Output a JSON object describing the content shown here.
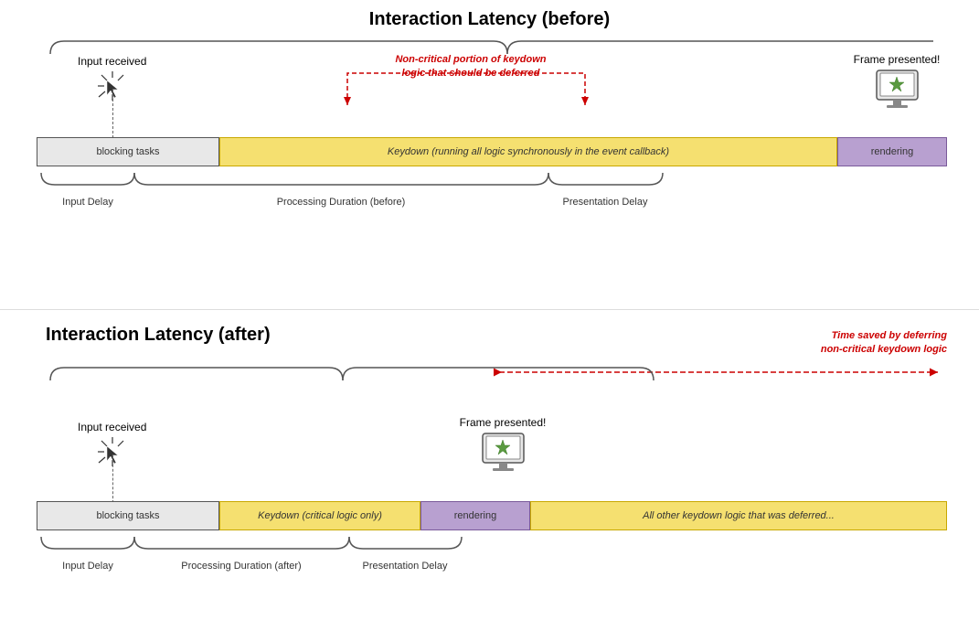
{
  "top": {
    "title": "Interaction Latency (before)",
    "label_input_received": "Input received",
    "label_frame_presented": "Frame presented!",
    "non_critical_text1": "Non-critical portion of keydown",
    "non_critical_text2": "logic that should be deferred",
    "bar_blocking": "blocking tasks",
    "bar_keydown": "Keydown (running all logic synchronously in the event callback)",
    "bar_rendering": "rendering",
    "label_input_delay": "Input Delay",
    "label_processing": "Processing Duration (before)",
    "label_presentation": "Presentation Delay"
  },
  "bottom": {
    "title": "Interaction Latency (after)",
    "label_input_received": "Input received",
    "label_frame_presented": "Frame presented!",
    "time_saved_text1": "Time saved by deferring",
    "time_saved_text2": "non-critical keydown logic",
    "bar_blocking": "blocking tasks",
    "bar_keydown": "Keydown (critical logic only)",
    "bar_rendering": "rendering",
    "bar_deferred": "All other keydown logic that was deferred...",
    "label_input_delay": "Input Delay",
    "label_processing": "Processing Duration (after)",
    "label_presentation": "Presentation Delay"
  }
}
